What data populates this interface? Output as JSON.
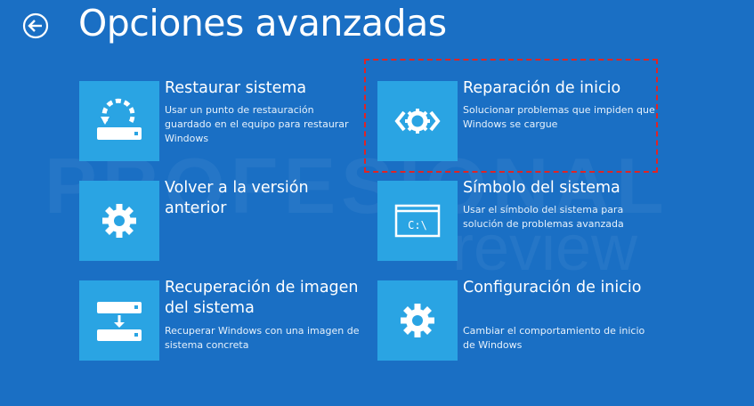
{
  "header": {
    "title": "Opciones avanzadas"
  },
  "tiles": [
    {
      "title": "Restaurar sistema",
      "description": "Usar un punto de restauración guardado en el equipo para restaurar Windows"
    },
    {
      "title": "Reparación de inicio",
      "description": "Solucionar problemas que impiden que Windows se cargue"
    },
    {
      "title": "Volver a la versión anterior",
      "description": ""
    },
    {
      "title": "Símbolo del sistema",
      "description": "Usar el símbolo del sistema para solución de problemas avanzada",
      "icon_text": "C:\\"
    },
    {
      "title": "Recuperación de imagen del sistema",
      "description": "Recuperar Windows con una imagen de sistema concreta"
    },
    {
      "title": "Configuración de inicio",
      "description": "Cambiar el comportamiento de inicio de Windows"
    }
  ],
  "watermark": {
    "line1": "PROFESIONAL",
    "line2": "review"
  },
  "colors": {
    "background": "#1a6fc4",
    "tile_icon": "#2aa4e3",
    "highlight": "#e02424"
  },
  "icons": {
    "back": "back-arrow-icon",
    "restore": "system-restore-icon",
    "repair": "startup-repair-icon",
    "previous_version": "gear-icon",
    "command_prompt": "command-prompt-icon",
    "image_recovery": "image-recovery-icon",
    "startup_settings": "gear-icon"
  }
}
